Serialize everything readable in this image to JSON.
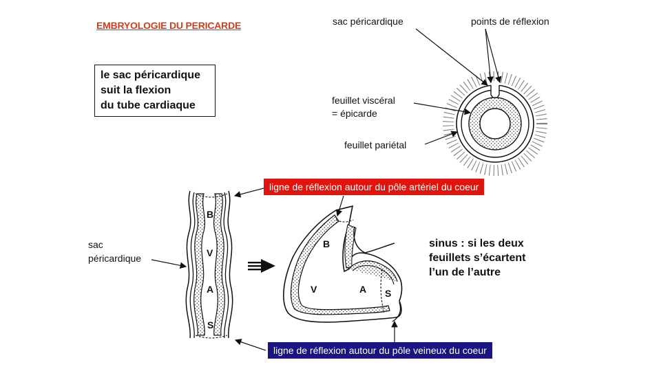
{
  "title": "EMBRYOLOGIE DU PERICARDE",
  "box_lines": [
    "le sac péricardique",
    "suit la flexion",
    "du tube cardiaque"
  ],
  "labels": {
    "sac_pericardique_top": "sac péricardique",
    "points_reflexion": "points de réflexion",
    "feuillet_visceral": "feuillet viscéral",
    "epicarde": "= épicarde",
    "feuillet_parietal": "feuillet pariétal",
    "sac_left_1": "sac",
    "sac_left_2": "péricardique"
  },
  "banners": {
    "arterial": "ligne de réflexion autour du pôle artériel du coeur",
    "venous": "ligne de réflexion autour du pôle veineux du coeur"
  },
  "sinus_lines": [
    "sinus  : si les deux",
    "feuillets s’écartent",
    "l’un de l’autre"
  ],
  "tube_letters": [
    "B",
    "V",
    "A",
    "S"
  ],
  "heart_letters": [
    "B",
    "V",
    "A",
    "S"
  ],
  "colors": {
    "title": "#d23c1a",
    "banner_arterial": "#e0140c",
    "banner_venous": "#1a1580"
  }
}
